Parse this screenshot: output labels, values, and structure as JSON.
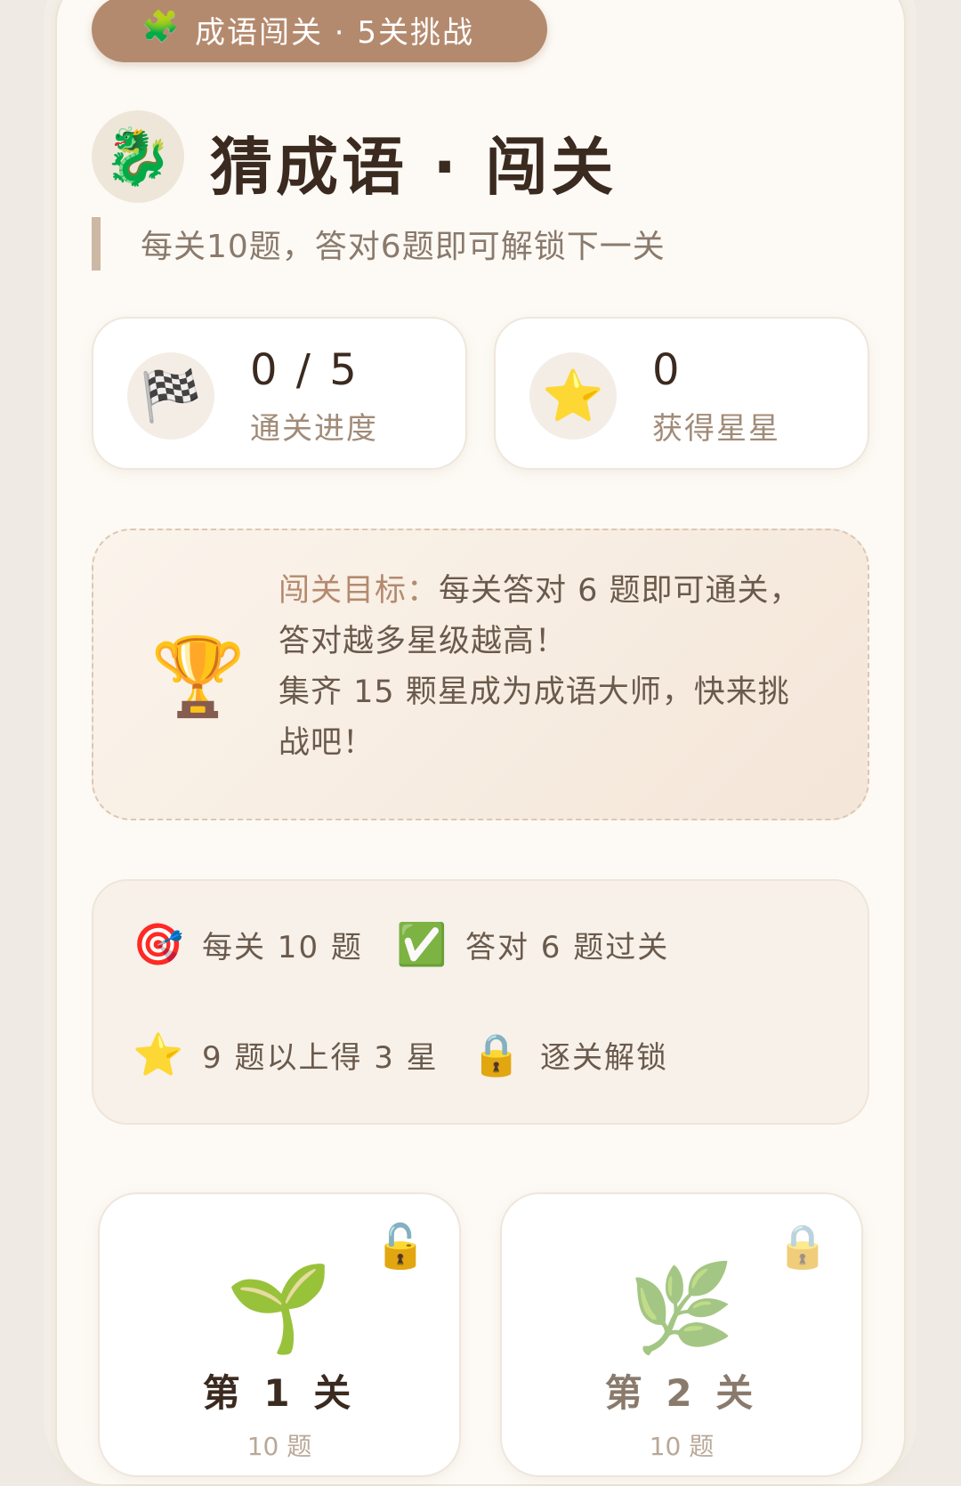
{
  "badge": {
    "icon": "puzzle-icon",
    "glyph": "🧩",
    "text": "成语闯关 · 5关挑战"
  },
  "header": {
    "avatar_icon": "dragon-icon",
    "avatar_glyph": "🐉",
    "title": "猜成语 · 闯关",
    "subtitle": "每关10题，答对6题即可解锁下一关"
  },
  "stats": [
    {
      "icon": "checkered-flag-icon",
      "glyph": "🏁",
      "value": "0 / 5",
      "label": "通关进度"
    },
    {
      "icon": "star-icon",
      "glyph": "⭐",
      "value": "0",
      "label": "获得星星"
    }
  ],
  "goal": {
    "icon": "trophy-icon",
    "glyph": "🏆",
    "label": "闯关目标：",
    "line1": "每关答对 6 题即可通关，答对越多星级越高！",
    "line2": "集齐 15 颗星成为成语大师，快来挑战吧！"
  },
  "rules": [
    {
      "icon": "target-icon",
      "glyph": "🎯",
      "text": "每关 10 题"
    },
    {
      "icon": "check-mark-icon",
      "glyph": "✅",
      "text": "答对 6 题过关"
    },
    {
      "icon": "star-icon",
      "glyph": "⭐",
      "text": "9 题以上得 3 星"
    },
    {
      "icon": "lock-icon",
      "glyph": "🔒",
      "text": "逐关解锁"
    }
  ],
  "levels": [
    {
      "name": "第 1 关",
      "emblem_icon": "seedling-icon",
      "emblem": "🌱",
      "lock_icon": "unlocked-icon",
      "lock": "🔓",
      "sub": "10 题",
      "locked": false,
      "color": "#3b2a1f"
    },
    {
      "name": "第 2 关",
      "emblem_icon": "herb-icon",
      "emblem": "🌿",
      "lock_icon": "locked-icon",
      "lock": "🔒",
      "sub": "10 题",
      "locked": true,
      "color": "#8a7a6c"
    }
  ]
}
